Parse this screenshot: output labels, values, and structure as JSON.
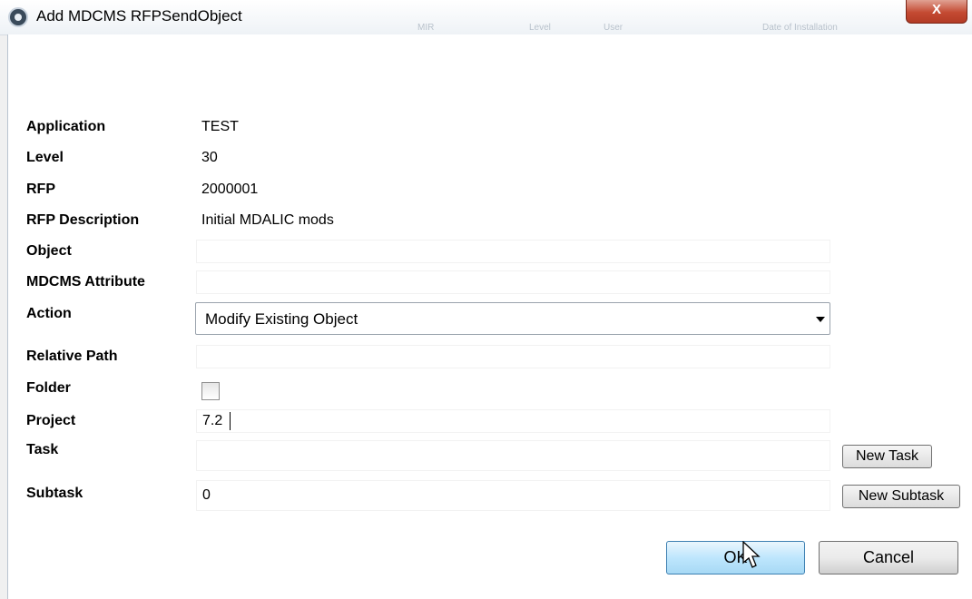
{
  "window": {
    "title": "Add MDCMS RFPSendObject",
    "close_symbol": "X",
    "background_text": [
      "MIR",
      "Level",
      "User",
      "Date of Installation"
    ]
  },
  "form": {
    "application": {
      "label": "Application",
      "value": "TEST"
    },
    "level": {
      "label": "Level",
      "value": "30"
    },
    "rfp": {
      "label": "RFP",
      "value": "2000001"
    },
    "rfp_description": {
      "label": "RFP Description",
      "value": "Initial MDALIC mods"
    },
    "object": {
      "label": "Object",
      "value": ""
    },
    "mdcms_attribute": {
      "label": "MDCMS Attribute",
      "value": ""
    },
    "action": {
      "label": "Action",
      "value": "Modify Existing Object"
    },
    "relative_path": {
      "label": "Relative Path",
      "value": ""
    },
    "folder": {
      "label": "Folder",
      "checked": false
    },
    "project": {
      "label": "Project",
      "value": "7.2"
    },
    "task": {
      "label": "Task",
      "value": "",
      "button": "New Task"
    },
    "subtask": {
      "label": "Subtask",
      "value": "0",
      "button": "New Subtask"
    }
  },
  "buttons": {
    "ok": "OK",
    "cancel": "Cancel"
  },
  "colors": {
    "close_button": "#c44a32",
    "ok_button": "#bee6fd",
    "field_border": "#f2f2f2"
  }
}
